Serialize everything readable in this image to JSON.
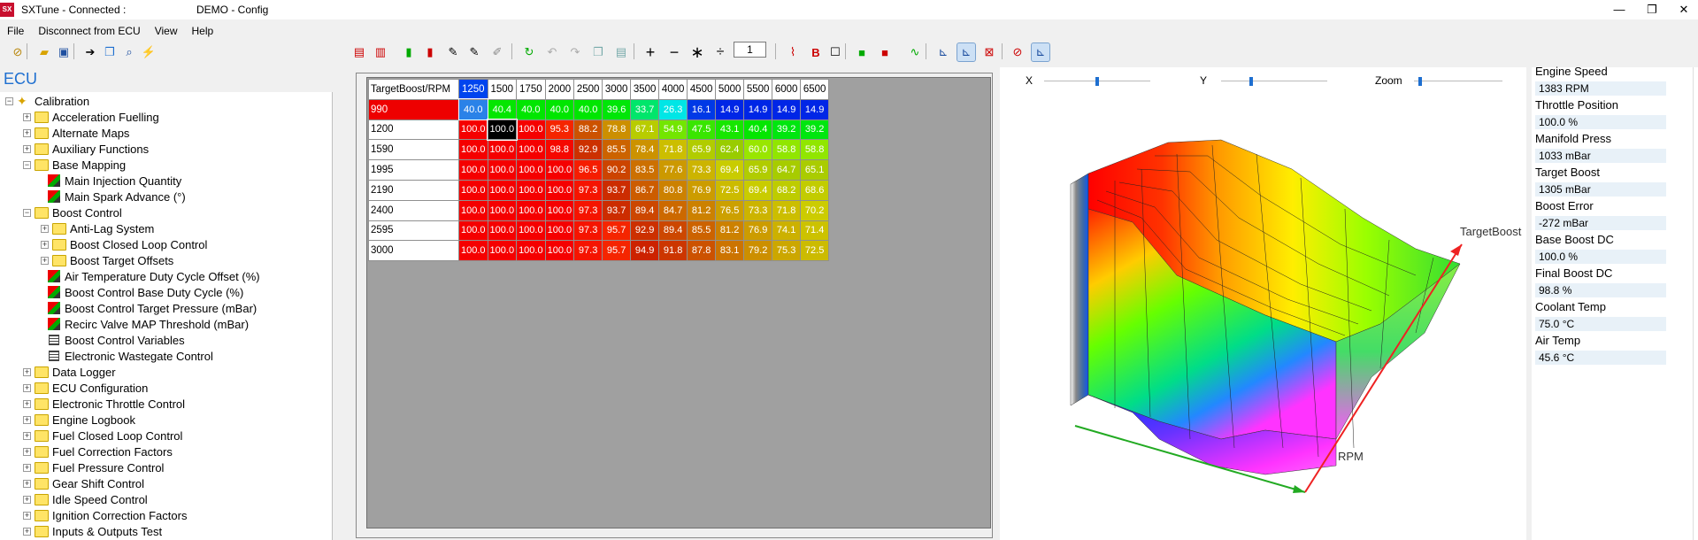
{
  "titlebar": {
    "app": "SXTune - Connected :",
    "doc": "DEMO - Config",
    "app_logo": "SX",
    "minimize": "—",
    "restore": "❐",
    "close": "✕"
  },
  "menu": [
    "File",
    "Disconnect from ECU",
    "View",
    "Help"
  ],
  "toolbar": {
    "step_value": "1"
  },
  "tree": {
    "header": "ECU",
    "root": "Calibration",
    "items": [
      {
        "label": "Acceleration Fuelling",
        "level": 1,
        "type": "folder",
        "exp": "+"
      },
      {
        "label": "Alternate Maps",
        "level": 1,
        "type": "folder",
        "exp": "+"
      },
      {
        "label": "Auxiliary Functions",
        "level": 1,
        "type": "folder",
        "exp": "+"
      },
      {
        "label": "Base Mapping",
        "level": 1,
        "type": "folder",
        "exp": "−"
      },
      {
        "label": "Main Injection Quantity",
        "level": 2,
        "type": "map"
      },
      {
        "label": "Main Spark Advance (°)",
        "level": 2,
        "type": "map"
      },
      {
        "label": "Boost Control",
        "level": 1,
        "type": "folder",
        "exp": "−"
      },
      {
        "label": "Anti-Lag System",
        "level": 2,
        "type": "folder",
        "exp": "+"
      },
      {
        "label": "Boost Closed Loop Control",
        "level": 2,
        "type": "folder",
        "exp": "+"
      },
      {
        "label": "Boost Target Offsets",
        "level": 2,
        "type": "folder",
        "exp": "+"
      },
      {
        "label": "Air Temperature Duty Cycle Offset (%)",
        "level": 2,
        "type": "map"
      },
      {
        "label": "Boost Control Base Duty Cycle (%)",
        "level": 2,
        "type": "map"
      },
      {
        "label": "Boost Control Target Pressure (mBar)",
        "level": 2,
        "type": "map"
      },
      {
        "label": "Recirc Valve MAP Threshold (mBar)",
        "level": 2,
        "type": "map"
      },
      {
        "label": "Boost Control Variables",
        "level": 2,
        "type": "grid"
      },
      {
        "label": "Electronic Wastegate Control",
        "level": 2,
        "type": "grid"
      },
      {
        "label": "Data Logger",
        "level": 1,
        "type": "folder",
        "exp": "+"
      },
      {
        "label": "ECU Configuration",
        "level": 1,
        "type": "folder",
        "exp": "+"
      },
      {
        "label": "Electronic Throttle Control",
        "level": 1,
        "type": "folder",
        "exp": "+"
      },
      {
        "label": "Engine Logbook",
        "level": 1,
        "type": "folder",
        "exp": "+"
      },
      {
        "label": "Fuel Closed Loop Control",
        "level": 1,
        "type": "folder",
        "exp": "+"
      },
      {
        "label": "Fuel Correction Factors",
        "level": 1,
        "type": "folder",
        "exp": "+"
      },
      {
        "label": "Fuel Pressure Control",
        "level": 1,
        "type": "folder",
        "exp": "+"
      },
      {
        "label": "Gear Shift Control",
        "level": 1,
        "type": "folder",
        "exp": "+"
      },
      {
        "label": "Idle Speed Control",
        "level": 1,
        "type": "folder",
        "exp": "+"
      },
      {
        "label": "Ignition Correction Factors",
        "level": 1,
        "type": "folder",
        "exp": "+"
      },
      {
        "label": "Inputs & Outputs Test",
        "level": 1,
        "type": "folder",
        "exp": "+"
      }
    ]
  },
  "table": {
    "corner": "TargetBoost/RPM",
    "columns": [
      "1250",
      "1500",
      "1750",
      "2000",
      "2500",
      "3000",
      "3500",
      "4000",
      "4500",
      "5000",
      "5500",
      "6000",
      "6500"
    ],
    "rows": [
      {
        "label": "990",
        "values": [
          "40.0",
          "40.4",
          "40.0",
          "40.0",
          "40.0",
          "39.6",
          "33.7",
          "26.3",
          "16.1",
          "14.9",
          "14.9",
          "14.9",
          "14.9"
        ]
      },
      {
        "label": "1200",
        "values": [
          "100.0",
          "100.0",
          "100.0",
          "95.3",
          "88.2",
          "78.8",
          "67.1",
          "54.9",
          "47.5",
          "43.1",
          "40.4",
          "39.2",
          "39.2"
        ]
      },
      {
        "label": "1590",
        "values": [
          "100.0",
          "100.0",
          "100.0",
          "98.8",
          "92.9",
          "85.5",
          "78.4",
          "71.8",
          "65.9",
          "62.4",
          "60.0",
          "58.8",
          "58.8"
        ]
      },
      {
        "label": "1995",
        "values": [
          "100.0",
          "100.0",
          "100.0",
          "100.0",
          "96.5",
          "90.2",
          "83.5",
          "77.6",
          "73.3",
          "69.4",
          "65.9",
          "64.7",
          "65.1"
        ]
      },
      {
        "label": "2190",
        "values": [
          "100.0",
          "100.0",
          "100.0",
          "100.0",
          "97.3",
          "93.7",
          "86.7",
          "80.8",
          "76.9",
          "72.5",
          "69.4",
          "68.2",
          "68.6"
        ]
      },
      {
        "label": "2400",
        "values": [
          "100.0",
          "100.0",
          "100.0",
          "100.0",
          "97.3",
          "93.7",
          "89.4",
          "84.7",
          "81.2",
          "76.5",
          "73.3",
          "71.8",
          "70.2"
        ]
      },
      {
        "label": "2595",
        "values": [
          "100.0",
          "100.0",
          "100.0",
          "100.0",
          "97.3",
          "95.7",
          "92.9",
          "89.4",
          "85.5",
          "81.2",
          "76.9",
          "74.1",
          "71.4"
        ]
      },
      {
        "label": "3000",
        "values": [
          "100.0",
          "100.0",
          "100.0",
          "100.0",
          "97.3",
          "95.7",
          "94.9",
          "91.8",
          "87.8",
          "83.1",
          "79.2",
          "75.3",
          "72.5"
        ]
      }
    ]
  },
  "view3d": {
    "x_label": "X",
    "y_label": "Y",
    "zoom_label": "Zoom",
    "axis_rpm": "RPM",
    "axis_target": "TargetBoost",
    "x_level": 0.5,
    "y_level": 0.28,
    "zoom_level": 0.05
  },
  "live": [
    {
      "label": "Engine Speed",
      "value": "1383 RPM"
    },
    {
      "label": "Throttle Position",
      "value": "100.0 %"
    },
    {
      "label": "Manifold Press",
      "value": "1033 mBar"
    },
    {
      "label": "Target Boost",
      "value": "1305 mBar"
    },
    {
      "label": "Boost Error",
      "value": "-272 mBar"
    },
    {
      "label": "Base Boost DC",
      "value": "100.0 %"
    },
    {
      "label": "Final Boost DC",
      "value": "98.8 %"
    },
    {
      "label": "Coolant Temp",
      "value": "75.0 °C"
    },
    {
      "label": "Air Temp",
      "value": "45.6 °C"
    }
  ]
}
